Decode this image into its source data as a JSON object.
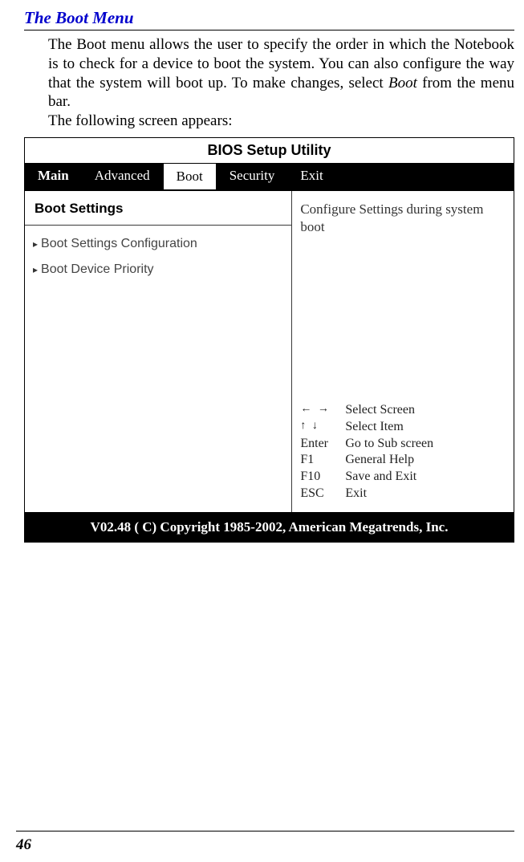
{
  "section_title": "The Boot Menu",
  "body_text_1": "The Boot menu allows the user to specify the order in which the Notebook is to check for a device to boot the system.  You can also configure the way that the system will boot up.  To make changes, select ",
  "body_text_boot": "Boot",
  "body_text_2": " from the menu bar.",
  "body_text_3": "The following screen appears:",
  "bios": {
    "title": "BIOS Setup Utility",
    "tabs": {
      "main": "Main",
      "advanced": "Advanced",
      "boot": "Boot",
      "security": "Security",
      "exit": "Exit"
    },
    "panel_header": "Boot Settings",
    "menu_items": {
      "config": "Boot Settings Configuration",
      "priority": "Boot Device Priority"
    },
    "help_text": "Configure Settings during system boot",
    "keys": {
      "lr_arrows": "← →",
      "lr_label": "Select Screen",
      "ud_arrows": "↑ ↓",
      "ud_label": "Select Item",
      "enter": "Enter",
      "enter_label": "Go to Sub screen",
      "f1": "F1",
      "f1_label": "General Help",
      "f10": "F10",
      "f10_label": "Save and Exit",
      "esc": "ESC",
      "esc_label": "Exit"
    },
    "footer": "V02.48  ( C) Copyright 1985-2002, American Megatrends, Inc."
  },
  "page_number": "46"
}
